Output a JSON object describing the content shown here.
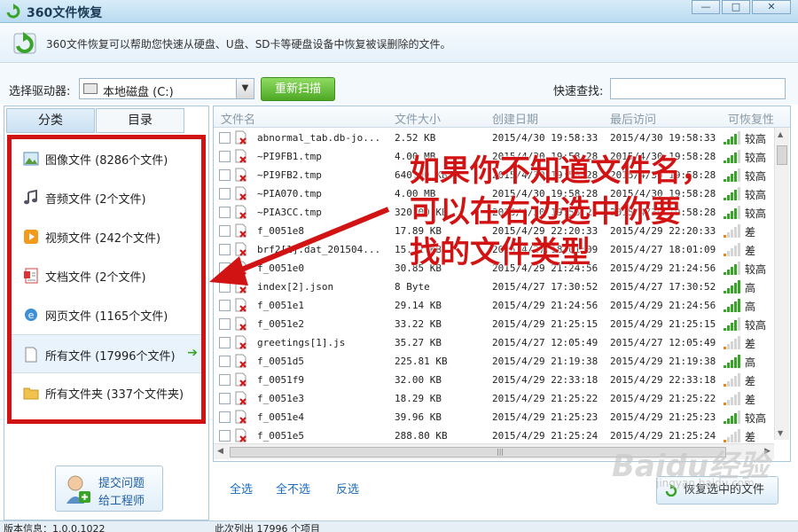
{
  "window": {
    "title": "360文件恢复",
    "min": "—",
    "max": "□",
    "close": "✕"
  },
  "info": {
    "text": "360文件恢复可以帮助您快速从硬盘、U盘、SD卡等硬盘设备中恢复被误删除的文件。"
  },
  "toolbar": {
    "drive_label": "选择驱动器:",
    "drive_value": "本地磁盘 (C:)",
    "rescan_label": "重新扫描",
    "search_label": "快速查找:",
    "search_value": ""
  },
  "sidebar": {
    "tabs": [
      "分类",
      "目录"
    ],
    "categories": [
      {
        "label": "图像文件 (8286个文件)",
        "icon": "image-icon"
      },
      {
        "label": "音频文件 (2个文件)",
        "icon": "music-icon"
      },
      {
        "label": "视频文件 (242个文件)",
        "icon": "video-icon"
      },
      {
        "label": "文档文件 (2个文件)",
        "icon": "document-icon"
      },
      {
        "label": "网页文件 (1165个文件)",
        "icon": "web-icon"
      },
      {
        "label": "所有文件 (17996个文件)",
        "icon": "file-icon"
      },
      {
        "label": "所有文件夹 (337个文件夹)",
        "icon": "folder-icon"
      }
    ],
    "support_line1": "提交问题",
    "support_line2": "给工程师"
  },
  "table": {
    "headers": [
      "文件名",
      "文件大小",
      "创建日期",
      "最后访问",
      "可恢复性"
    ],
    "rows": [
      {
        "name": "abnormal_tab.db-jo...",
        "size": "2.52 KB",
        "created": "2015/4/30 19:58:33",
        "accessed": "2015/4/30 19:58:33",
        "recover": "较高",
        "level": 4
      },
      {
        "name": "~PI9FB1.tmp",
        "size": "4.00 MB",
        "created": "2015/4/30 19:58:28",
        "accessed": "2015/4/30 19:58:28",
        "recover": "较高",
        "level": 4
      },
      {
        "name": "~PI9FB2.tmp",
        "size": "640.00 KB",
        "created": "2015/4/30 19:58:28",
        "accessed": "2015/4/30 19:58:28",
        "recover": "较高",
        "level": 4
      },
      {
        "name": "~PIA070.tmp",
        "size": "4.00 MB",
        "created": "2015/4/30 19:58:28",
        "accessed": "2015/4/30 19:58:28",
        "recover": "较高",
        "level": 4
      },
      {
        "name": "~PIA3CC.tmp",
        "size": "320.00 KB",
        "created": "2015/4/30 19:58:28",
        "accessed": "2015/4/30 19:58:28",
        "recover": "较高",
        "level": 4
      },
      {
        "name": "f_0051e8",
        "size": "17.89 KB",
        "created": "2015/4/29 22:20:33",
        "accessed": "2015/4/29 22:20:33",
        "recover": "差",
        "level": 1
      },
      {
        "name": "brf2[1].dat_201504...",
        "size": "15.32 KB",
        "created": "2015/4/27 18:01:09",
        "accessed": "2015/4/27 18:01:09",
        "recover": "差",
        "level": 1
      },
      {
        "name": "f_0051e0",
        "size": "30.85 KB",
        "created": "2015/4/29 21:24:56",
        "accessed": "2015/4/29 21:24:56",
        "recover": "较高",
        "level": 4
      },
      {
        "name": "index[2].json",
        "size": "8 Byte",
        "created": "2015/4/27 17:30:52",
        "accessed": "2015/4/27 17:30:52",
        "recover": "高",
        "level": 5
      },
      {
        "name": "f_0051e1",
        "size": "29.14 KB",
        "created": "2015/4/29 21:24:56",
        "accessed": "2015/4/29 21:24:56",
        "recover": "高",
        "level": 5
      },
      {
        "name": "f_0051e2",
        "size": "33.22 KB",
        "created": "2015/4/29 21:25:15",
        "accessed": "2015/4/29 21:25:15",
        "recover": "较高",
        "level": 4
      },
      {
        "name": "greetings[1].js",
        "size": "35.27 KB",
        "created": "2015/4/27 12:05:49",
        "accessed": "2015/4/27 12:05:49",
        "recover": "差",
        "level": 1
      },
      {
        "name": "f_0051d5",
        "size": "225.81 KB",
        "created": "2015/4/29 21:19:38",
        "accessed": "2015/4/29 21:19:38",
        "recover": "高",
        "level": 5
      },
      {
        "name": "f_0051f9",
        "size": "32.00 KB",
        "created": "2015/4/29 22:33:18",
        "accessed": "2015/4/29 22:33:18",
        "recover": "差",
        "level": 1
      },
      {
        "name": "f_0051e3",
        "size": "18.29 KB",
        "created": "2015/4/29 21:25:22",
        "accessed": "2015/4/29 21:25:22",
        "recover": "差",
        "level": 1
      },
      {
        "name": "f_0051e4",
        "size": "39.96 KB",
        "created": "2015/4/29 21:25:23",
        "accessed": "2015/4/29 21:25:23",
        "recover": "较高",
        "level": 4
      },
      {
        "name": "f_0051e5",
        "size": "288.80 KB",
        "created": "2015/4/29 21:25:24",
        "accessed": "2015/4/29 21:25:24",
        "recover": "差",
        "level": 1
      }
    ]
  },
  "actions": {
    "select_all": "全选",
    "select_none": "全不选",
    "invert": "反选",
    "recover": "恢复选中的文件"
  },
  "status": {
    "version": "版本信息：1.0.0.1022",
    "count": "此次列出 17996 个项目"
  },
  "annotation": {
    "lines": [
      "如果你不知道文件名，",
      "可以在右边选中你要",
      "找的文件类型"
    ],
    "color": "#d21313"
  },
  "watermark": {
    "main": "Baidu经验",
    "sub": "jingyan.baidu.com"
  },
  "colors": {
    "accent_green": "#4da824",
    "highlight_red": "#d21313",
    "link_blue": "#1c6bbb"
  }
}
